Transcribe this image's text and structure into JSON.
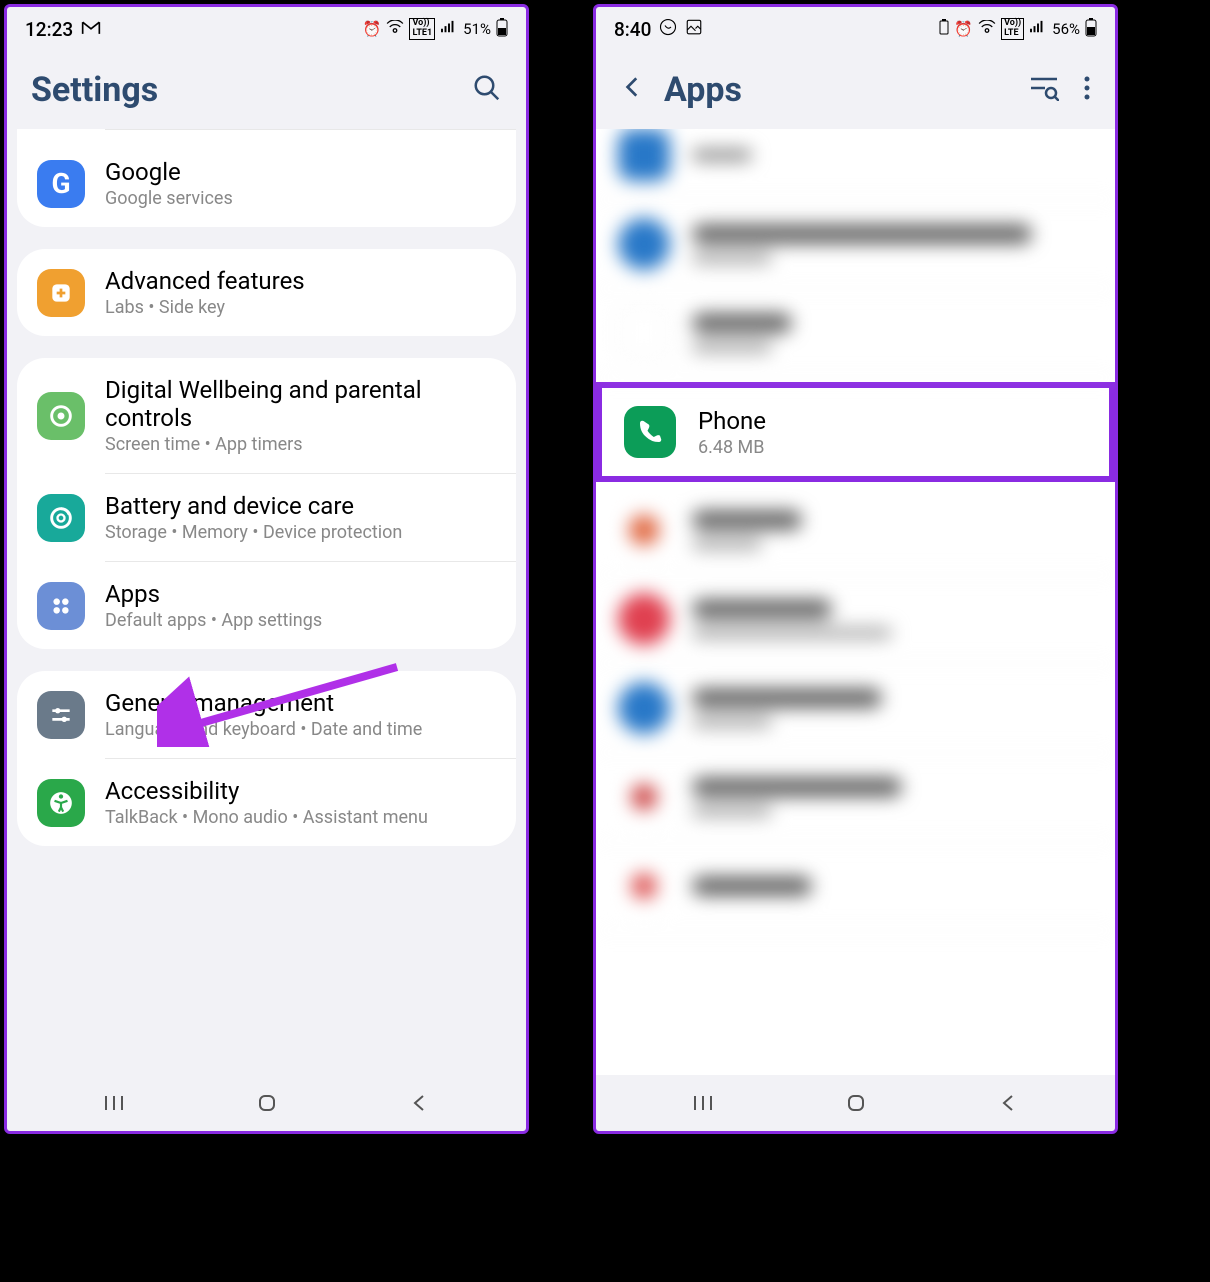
{
  "phone1": {
    "status": {
      "time": "12:23",
      "battery": "51%"
    },
    "header": {
      "title": "Settings"
    },
    "groups": [
      {
        "items": [
          {
            "title": "Google",
            "sub": "Google services",
            "icon_color": "#3a7cf0",
            "icon": "G"
          }
        ]
      },
      {
        "items": [
          {
            "title": "Advanced features",
            "sub": "Labs  •  Side key",
            "icon_color": "#f0a030",
            "icon": "plus"
          }
        ]
      },
      {
        "items": [
          {
            "title": "Digital Wellbeing and parental controls",
            "sub": "Screen time  •  App timers",
            "icon_color": "#4cb050",
            "icon": "circle"
          },
          {
            "title": "Battery and device care",
            "sub": "Storage  •  Memory  •  Device protection",
            "icon_color": "#18a99a",
            "icon": "refresh"
          },
          {
            "title": "Apps",
            "sub": "Default apps  •  App settings",
            "icon_color": "#6c8fd6",
            "icon": "grid"
          }
        ]
      },
      {
        "items": [
          {
            "title": "General management",
            "sub": "Language and keyboard  •  Date and time",
            "icon_color": "#6a7a8a",
            "icon": "sliders"
          },
          {
            "title": "Accessibility",
            "sub": "TalkBack  •  Mono audio  •  Assistant menu",
            "icon_color": "#2aa84a",
            "icon": "person"
          }
        ]
      }
    ]
  },
  "phone2": {
    "status": {
      "time": "8:40",
      "battery": "56%"
    },
    "header": {
      "title": "Apps"
    },
    "phone_app": {
      "name": "Phone",
      "size": "6.48 MB"
    }
  }
}
